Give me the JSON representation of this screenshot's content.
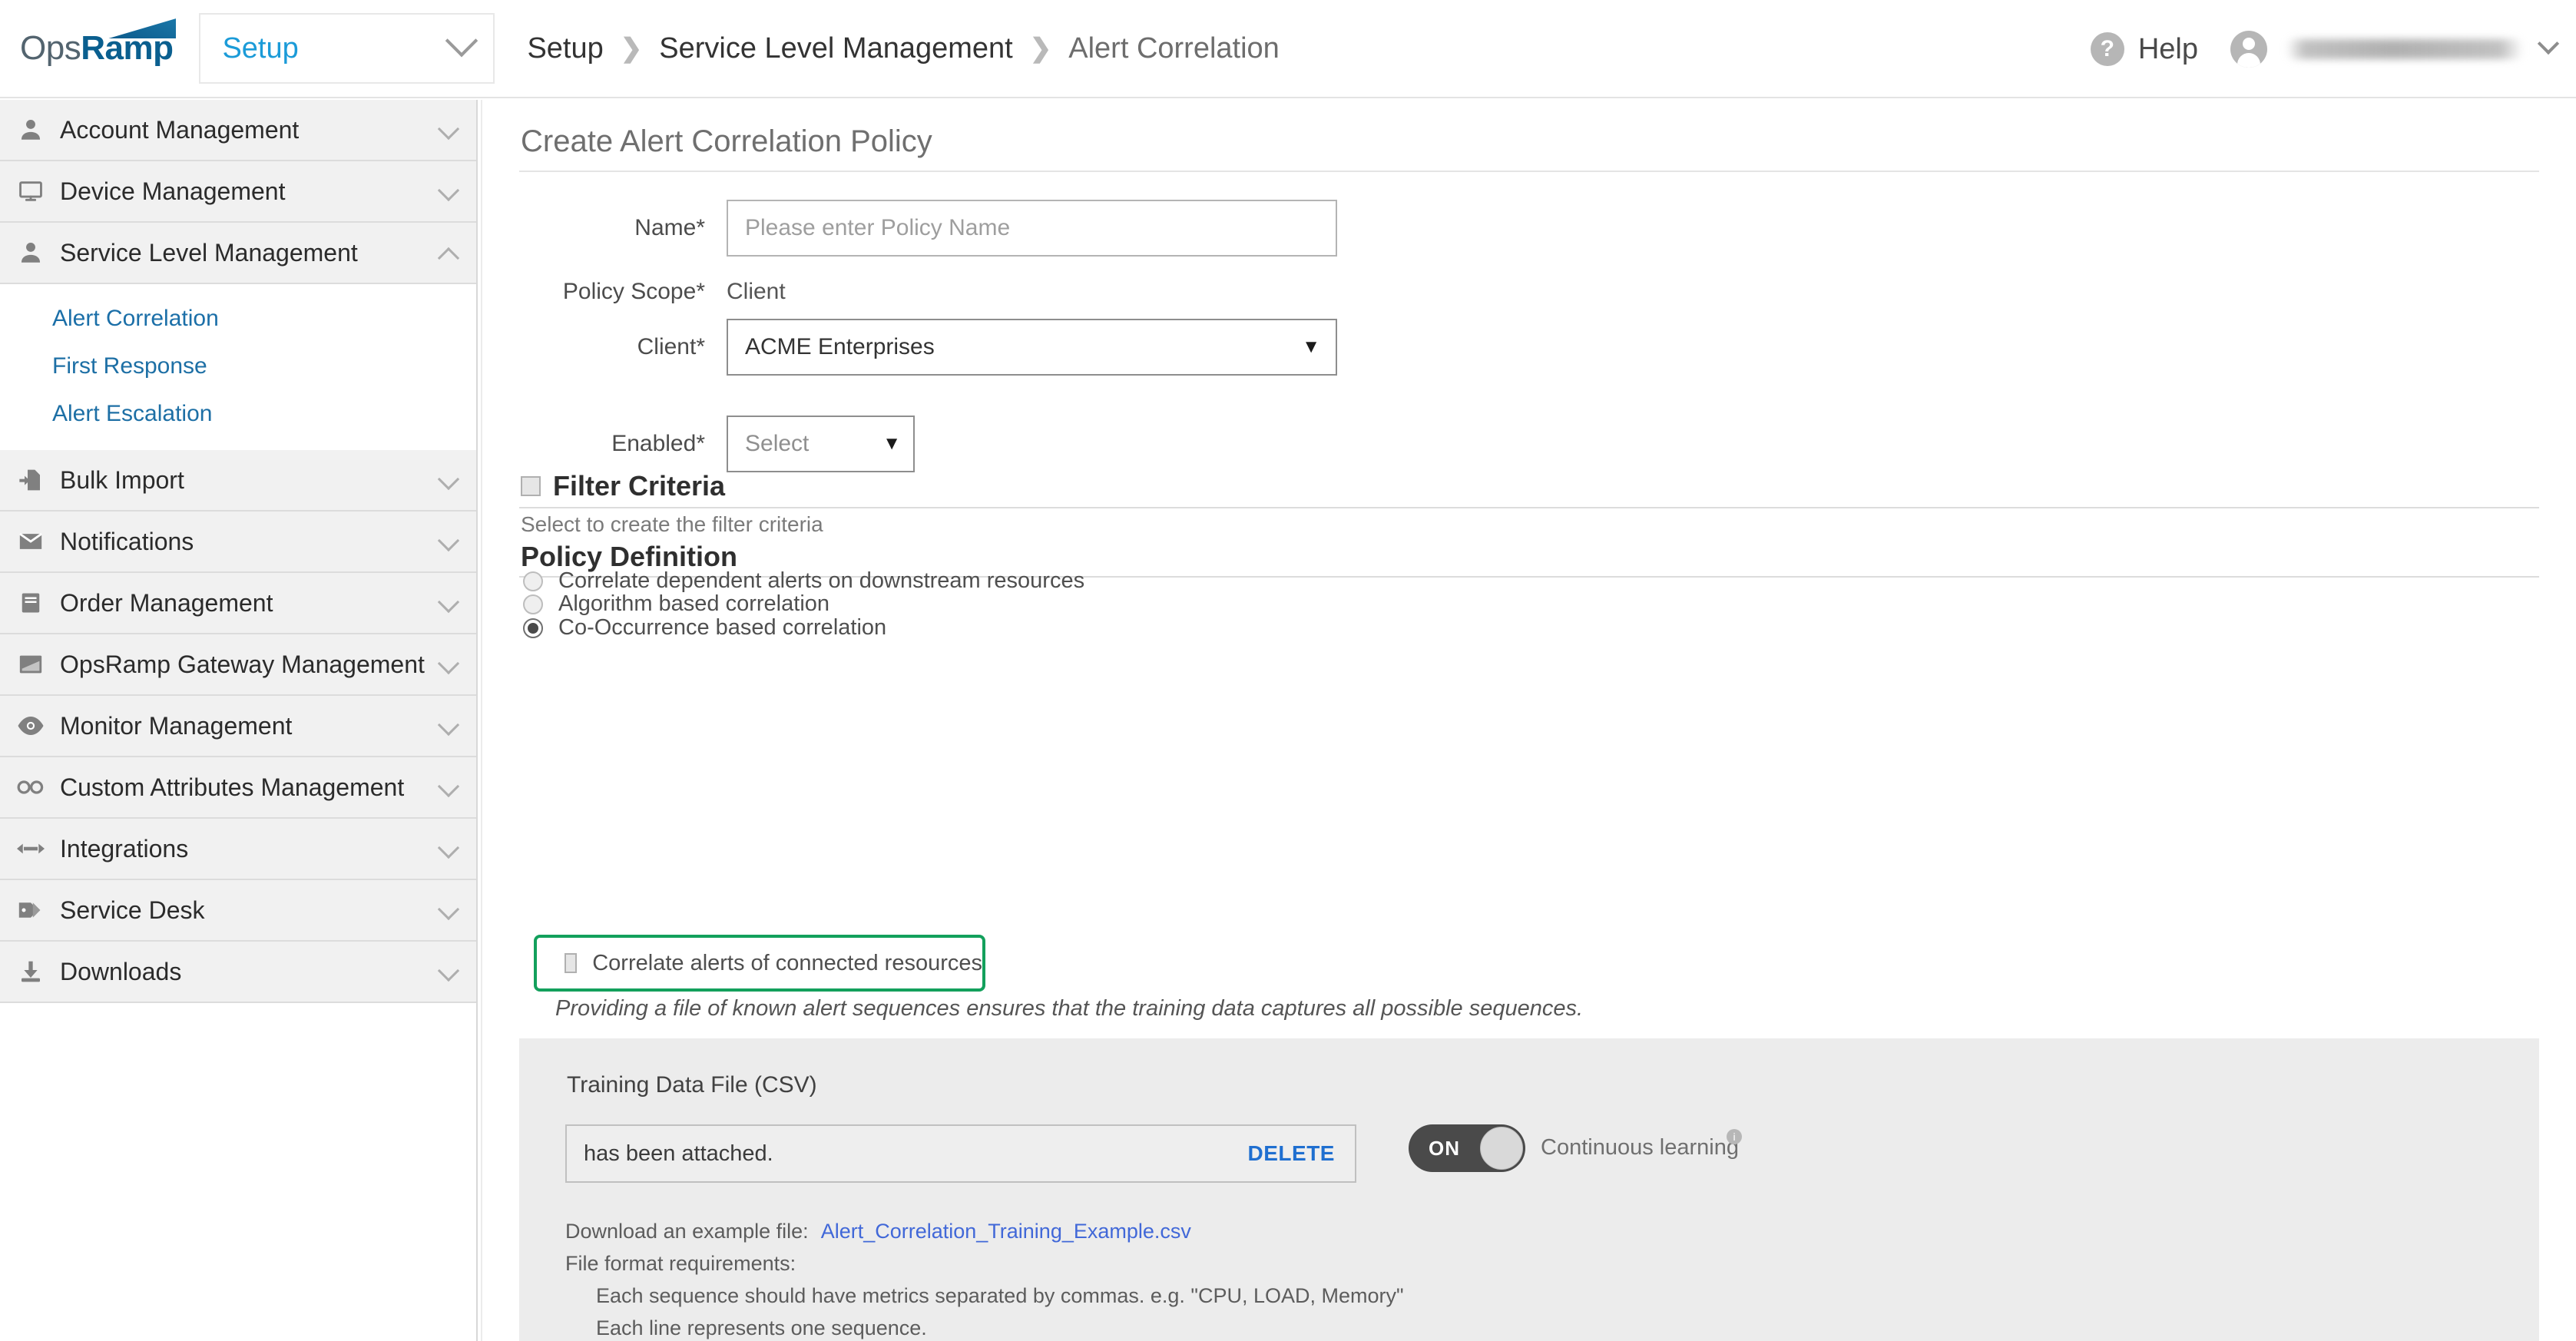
{
  "topbar": {
    "logo_ops": "Ops",
    "logo_ramp": "Ramp",
    "module_selector": "Setup",
    "breadcrumb": [
      "Setup",
      "Service Level Management",
      "Alert Correlation"
    ],
    "breadcrumb_separator": "❯",
    "help_label": "Help",
    "help_icon": "question-mark-icon",
    "user_name": ""
  },
  "sidebar": {
    "items": [
      {
        "label": "Account Management",
        "icon": "user-icon",
        "expanded": false
      },
      {
        "label": "Device Management",
        "icon": "monitor-icon",
        "expanded": false
      },
      {
        "label": "Service Level Management",
        "icon": "user-icon",
        "expanded": true
      },
      {
        "label": "Bulk Import",
        "icon": "file-import-icon",
        "expanded": false
      },
      {
        "label": "Notifications",
        "icon": "envelope-icon",
        "expanded": false
      },
      {
        "label": "Order Management",
        "icon": "book-icon",
        "expanded": false
      },
      {
        "label": "OpsRamp Gateway Management",
        "icon": "gateway-icon",
        "expanded": false
      },
      {
        "label": "Monitor Management",
        "icon": "eye-icon",
        "expanded": false
      },
      {
        "label": "Custom Attributes Management",
        "icon": "infinity-icon",
        "expanded": false
      },
      {
        "label": "Integrations",
        "icon": "plug-icon",
        "expanded": false
      },
      {
        "label": "Service Desk",
        "icon": "tag-icon",
        "expanded": false
      },
      {
        "label": "Downloads",
        "icon": "download-icon",
        "expanded": false
      }
    ],
    "sub_items": [
      {
        "label": "Alert Correlation",
        "active": true
      },
      {
        "label": "First Response",
        "active": false
      },
      {
        "label": "Alert Escalation",
        "active": false
      }
    ]
  },
  "form": {
    "panel_title": "Create Alert Correlation Policy",
    "name_label": "Name",
    "name_required": "*",
    "name_placeholder": "Please enter Policy Name",
    "name_value": "",
    "policy_scope_label": "Policy Scope",
    "policy_scope_required": "*",
    "policy_scope_value": "Client",
    "client_label": "Client*",
    "client_value": "ACME Enterprises",
    "enabled_label": "Enabled",
    "enabled_required": "*",
    "enabled_value": "Select",
    "dropdown_caret": "▼"
  },
  "filter_criteria": {
    "title": "Filter Criteria",
    "checked": false,
    "hint": "Select to create the filter criteria"
  },
  "policy_definition": {
    "title": "Policy Definition",
    "options": [
      {
        "label": "Correlate dependent alerts on downstream resources",
        "selected": false
      },
      {
        "label": "Algorithm based correlation",
        "selected": false
      },
      {
        "label": "Co-Occurrence based correlation",
        "selected": true
      }
    ],
    "connected_checkbox": {
      "label": "Correlate alerts of connected resources",
      "checked": false,
      "highlight_color": "#13a05c"
    },
    "note": "Providing a file of known alert sequences ensures that the training data captures all possible sequences."
  },
  "training": {
    "title": "Training Data File (CSV)",
    "file_status": "has been attached.",
    "delete_label": "DELETE",
    "toggle_state": "ON",
    "continuous_learning_label": "Continuous learning",
    "info_icon": "info-icon",
    "download_prefix": "Download an example file:",
    "download_link": "Alert_Correlation_Training_Example.csv",
    "format_title": "File format requirements:",
    "format_line1": "Each sequence should have metrics separated by commas. e.g. \"CPU, LOAD, Memory\"",
    "format_line2": "Each line represents one sequence."
  }
}
